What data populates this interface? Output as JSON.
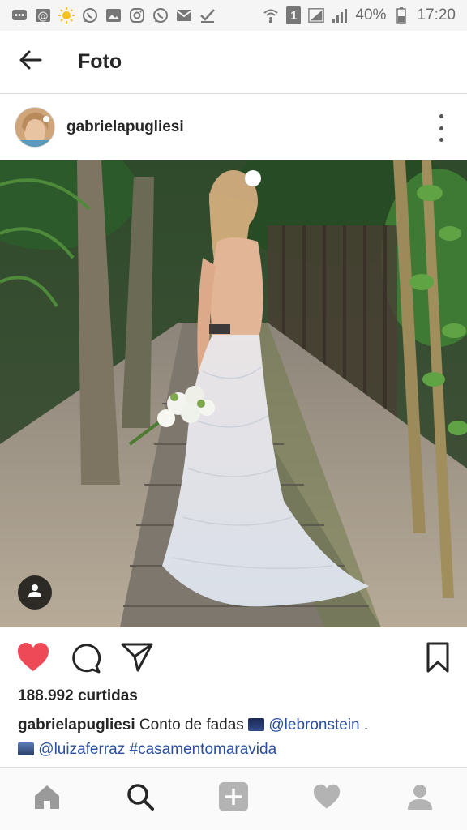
{
  "status_bar": {
    "icons": [
      "messages-icon",
      "at-icon",
      "sun-icon",
      "whatsapp-icon",
      "image-icon",
      "instagram-icon",
      "whatsapp-icon",
      "mail-icon",
      "check-icon"
    ],
    "sim_label": "1",
    "battery": "40%",
    "time": "17:20"
  },
  "app_bar": {
    "title": "Foto"
  },
  "post": {
    "username": "gabrielapugliesi",
    "likes": "188.992 curtidas",
    "caption": {
      "user": "gabrielapugliesi",
      "text": " Conto de fadas ",
      "mention1": "@lebronstein",
      "punct": " .",
      "mention2": "@luizaferraz",
      "hashtag": "#casamentomaravida"
    }
  },
  "colors": {
    "like_red": "#ed4956",
    "link_blue": "#2a4f9e",
    "text": "#262626"
  },
  "bottom_nav": [
    "home-icon",
    "search-icon",
    "add-icon",
    "heart-icon",
    "profile-icon"
  ]
}
